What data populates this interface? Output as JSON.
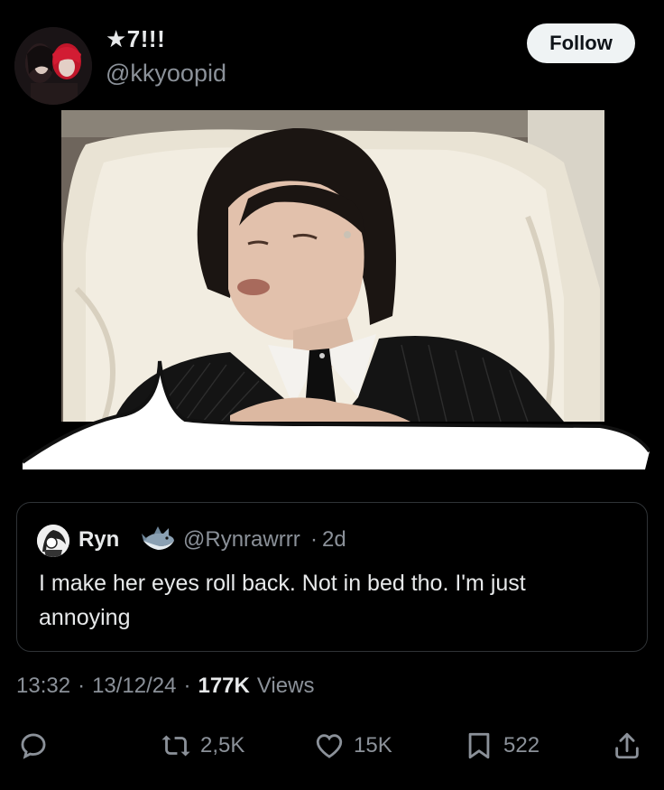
{
  "author": {
    "display_name": "★7!!!",
    "handle": "@kkyoopid",
    "follow_label": "Follow"
  },
  "quote": {
    "name": "Ryn",
    "emoji": "shark-emoji",
    "handle": "@Rynrawrrr",
    "separator": "·",
    "age": "2d",
    "text": "I make her eyes roll back. Not in bed tho. I'm just annoying"
  },
  "meta": {
    "time": "13:32",
    "sep1": "·",
    "date": "13/12/24",
    "sep2": "·",
    "views_count": "177K",
    "views_label": "Views"
  },
  "actions": {
    "reply_icon": "reply-icon",
    "retweets": "2,5K",
    "likes": "15K",
    "bookmarks": "522",
    "share_icon": "share-icon"
  },
  "colors": {
    "background": "#000000",
    "text": "#e7e9ea",
    "muted": "#8b9199",
    "border": "#2f3336",
    "follow_bg": "#eff3f4"
  }
}
